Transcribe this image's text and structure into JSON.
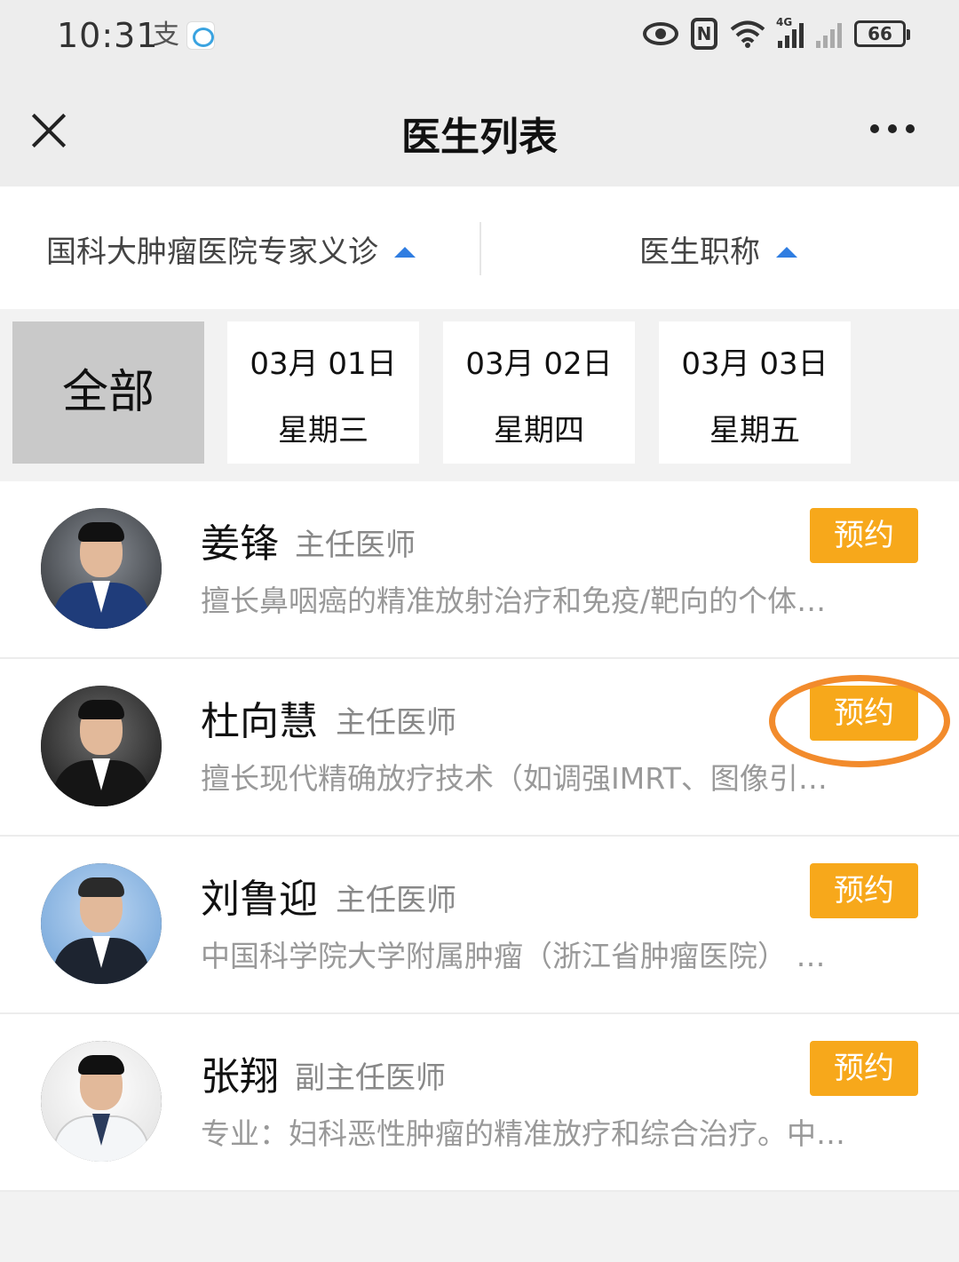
{
  "status_bar": {
    "time": "10:31",
    "alipay_glyph": "支",
    "battery": "66",
    "signal_label": "4G",
    "icons": [
      "alipay-icon",
      "message-icon",
      "eye-icon",
      "nfc-icon",
      "wifi-icon",
      "signal-icon",
      "battery-icon"
    ]
  },
  "nav": {
    "title": "医生列表",
    "close_icon": "close-icon",
    "more_icon": "more-icon"
  },
  "filters": {
    "hospital": "国科大肿瘤医院专家义诊",
    "doctor_title": "医生职称",
    "accent_color": "#2f7de1"
  },
  "dates": {
    "all_label": "全部",
    "tabs": [
      {
        "date": "03月 01日",
        "weekday": "星期三"
      },
      {
        "date": "03月 02日",
        "weekday": "星期四"
      },
      {
        "date": "03月 03日",
        "weekday": "星期五"
      }
    ]
  },
  "doctors": [
    {
      "name": "姜锋",
      "title": "主任医师",
      "desc": "擅长鼻咽癌的精准放射治疗和免疫/靶向的个体…",
      "button": "预约"
    },
    {
      "name": "杜向慧",
      "title": "主任医师",
      "desc": "擅长现代精确放疗技术（如调强IMRT、图像引…",
      "button": "预约"
    },
    {
      "name": "刘鲁迎",
      "title": "主任医师",
      "desc": "中国科学院大学附属肿瘤（浙江省肿瘤医院） …",
      "button": "预约"
    },
    {
      "name": "张翔",
      "title": "副主任医师",
      "desc": "专业：妇科恶性肿瘤的精准放疗和综合治疗。中…",
      "button": "预约"
    }
  ],
  "colors": {
    "button": "#f7a81b",
    "highlight": "#f28b2c"
  }
}
